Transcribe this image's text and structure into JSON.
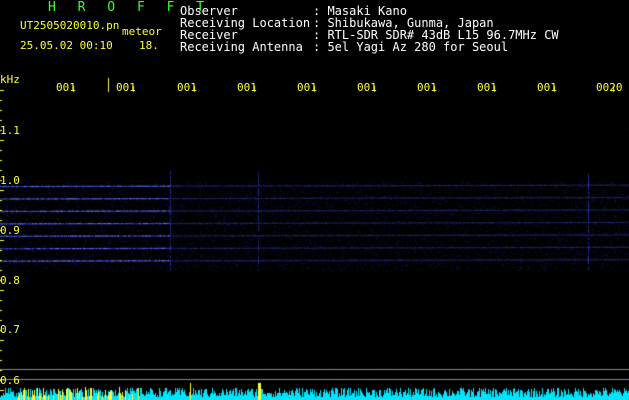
{
  "header": {
    "app_name": "H R O F F T",
    "filename": "UT2505020010.pn",
    "meteor_label": "meteor",
    "date_time": "25.05.02 00:10",
    "count": "18.",
    "fields": [
      {
        "label": "Observer",
        "value": ": Masaki Kano"
      },
      {
        "label": "Receiving Location",
        "value": ": Shibukawa, Gunma, Japan"
      },
      {
        "label": "Receiver",
        "value": ": RTL-SDR SDR# 43dB L15 96.7MHz CW"
      },
      {
        "label": "Receiving Antenna",
        "value": ": 5el Yagi Az 280 for Seoul"
      }
    ]
  },
  "chart_data": {
    "type": "heatmap",
    "ylabel": "kHz",
    "y_ticks": [
      "1.1",
      "1.0",
      "0.9",
      "0.8",
      "0.7",
      "0.6"
    ],
    "x_ticks": [
      "001",
      "001",
      "001",
      "001",
      "001",
      "001",
      "001",
      "001",
      "001",
      "0020"
    ],
    "ylim": [
      0.58,
      1.15
    ],
    "carrier_lines_khz": [
      0.99,
      0.965,
      0.94,
      0.915,
      0.89,
      0.865,
      0.84
    ],
    "colors": {
      "background": "#000000",
      "signal": "#3344ff",
      "text_primary": "#ffffff",
      "text_secondary": "#ffff33",
      "title": "#33ff33",
      "baseline_strip": "#00e5ff"
    }
  }
}
